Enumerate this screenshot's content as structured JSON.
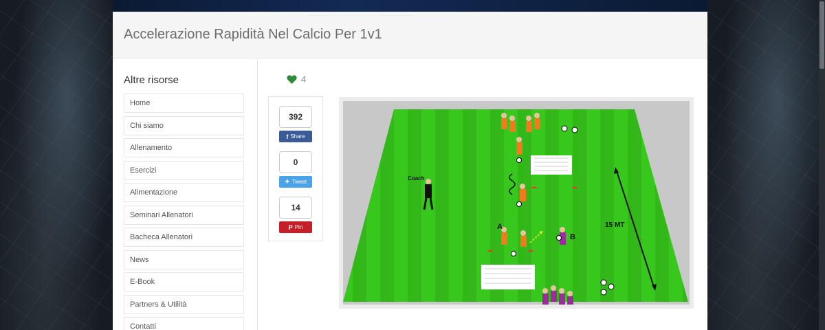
{
  "page": {
    "title": "Accelerazione Rapidità Nel Calcio Per 1v1"
  },
  "sidebar": {
    "heading": "Altre risorse",
    "items": [
      {
        "label": "Home"
      },
      {
        "label": "Chi siamo"
      },
      {
        "label": "Allenamento"
      },
      {
        "label": "Esercizi"
      },
      {
        "label": "Alimentazione"
      },
      {
        "label": "Seminari Allenatori"
      },
      {
        "label": "Bacheca Allenatori"
      },
      {
        "label": "News"
      },
      {
        "label": "E-Book"
      },
      {
        "label": "Partners & Utilità"
      },
      {
        "label": "Contatti"
      }
    ]
  },
  "likes": {
    "count": "4",
    "icon": "heart-icon",
    "color": "#2e8b3a"
  },
  "share": {
    "facebook": {
      "count": "392",
      "label": "Share",
      "icon": "facebook-icon",
      "color": "#3b5a98"
    },
    "twitter": {
      "count": "0",
      "label": "Tweet",
      "icon": "twitter-icon",
      "color": "#4aa2e8"
    },
    "pinterest": {
      "count": "14",
      "label": "Pin",
      "icon": "pinterest-icon",
      "color": "#c51f2a"
    }
  },
  "drill": {
    "coach_label": "Coach",
    "player_a_label": "A",
    "player_b_label": "B",
    "distance_label": "15 MT",
    "field_color": "#35c21a",
    "team_orange": "#f07a1c",
    "team_purple": "#9a2d9a"
  }
}
